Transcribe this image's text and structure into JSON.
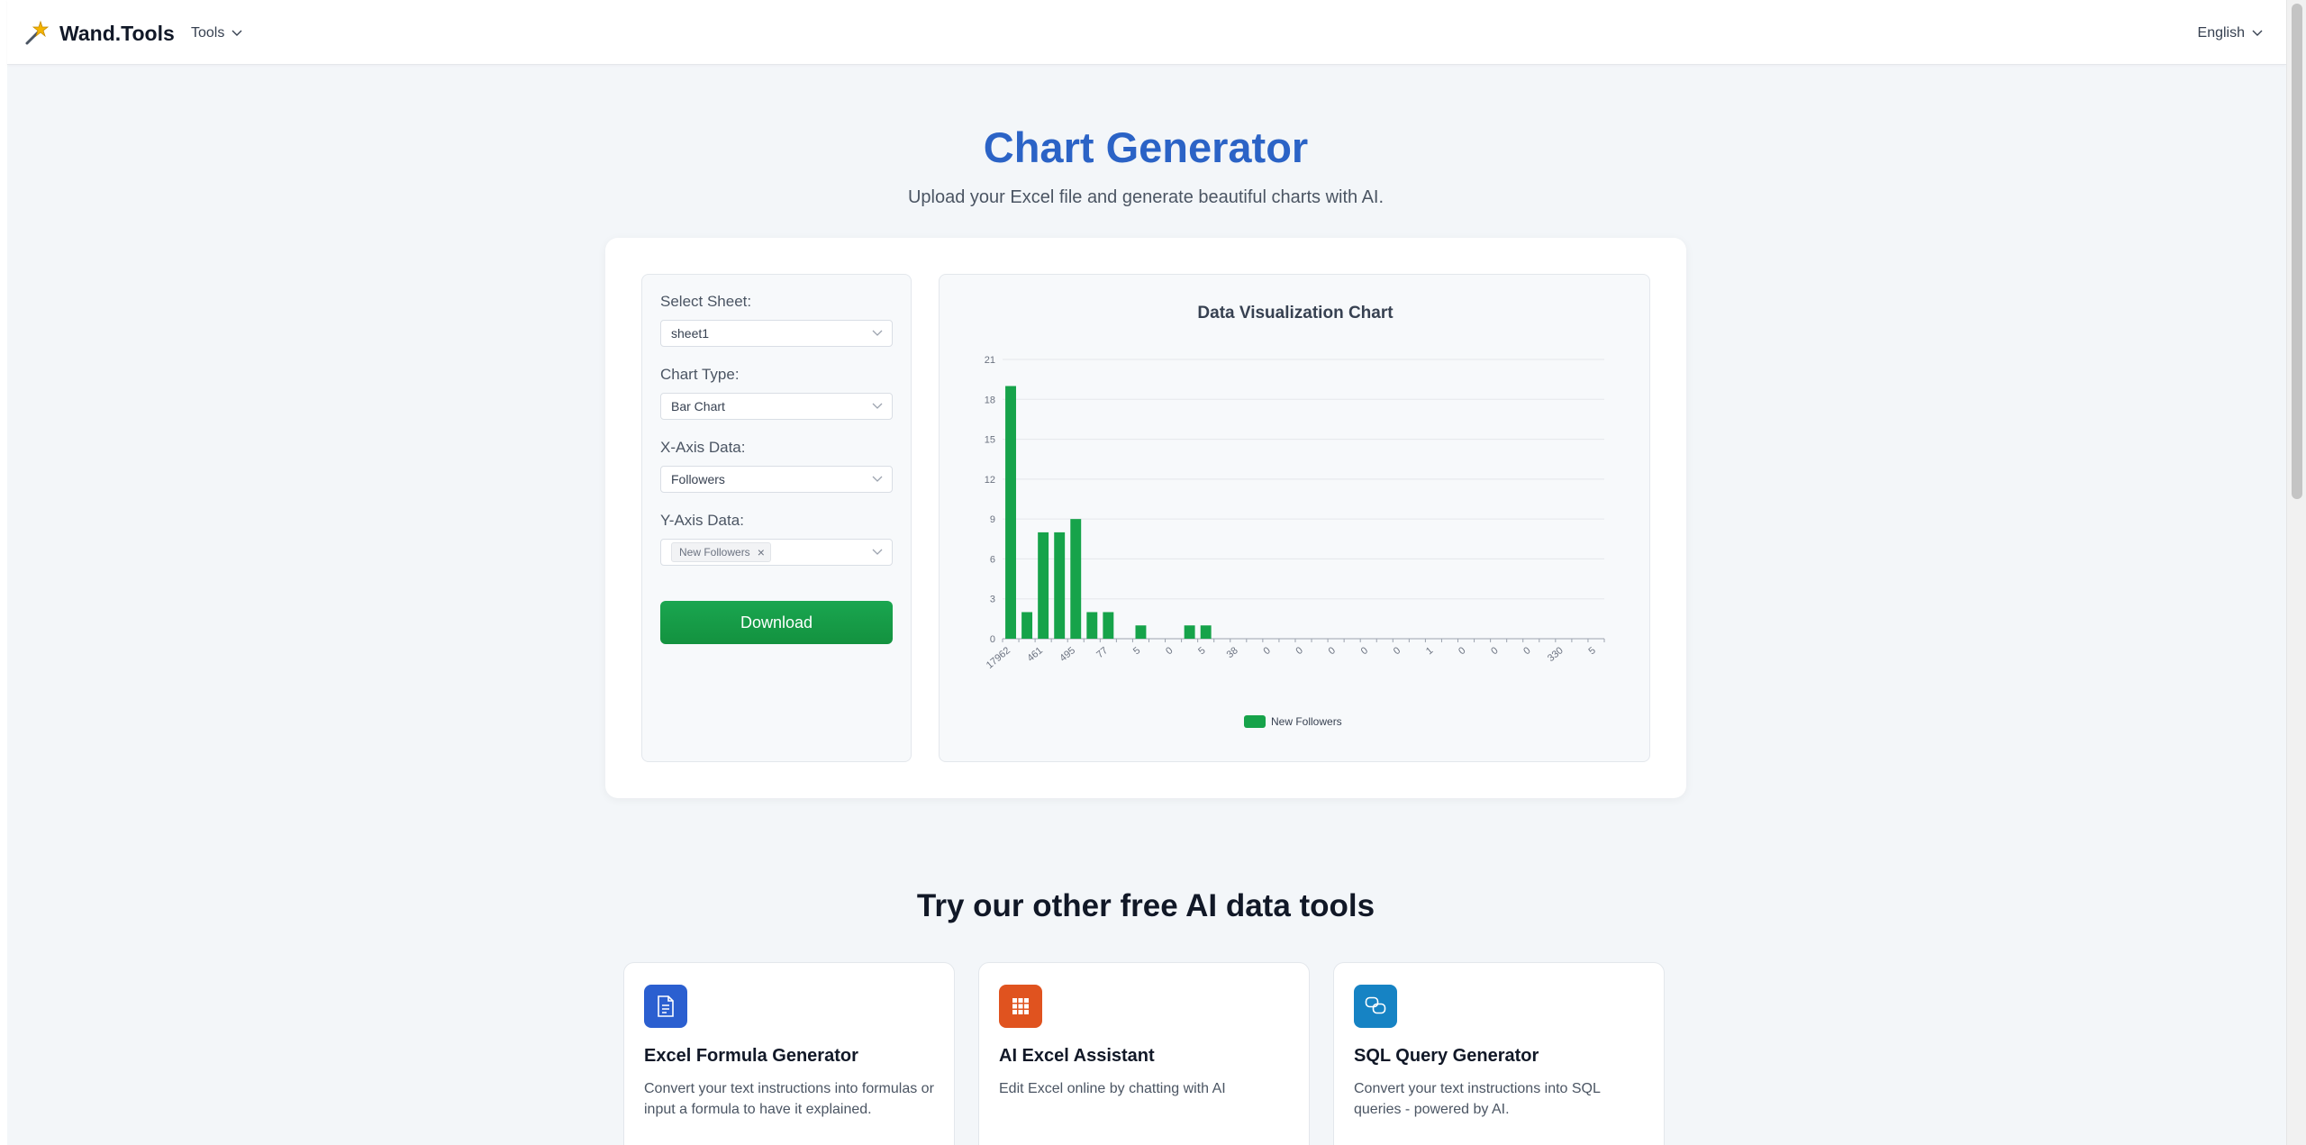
{
  "brand": {
    "name": "Wand.Tools"
  },
  "nav": {
    "tools_label": "Tools",
    "language_label": "English"
  },
  "hero": {
    "title": "Chart Generator",
    "subtitle": "Upload your Excel file and generate beautiful charts with AI."
  },
  "controls": {
    "sheet_label": "Select Sheet:",
    "sheet_value": "sheet1",
    "chart_type_label": "Chart Type:",
    "chart_type_value": "Bar Chart",
    "x_axis_label": "X-Axis Data:",
    "x_axis_value": "Followers",
    "y_axis_label": "Y-Axis Data:",
    "y_axis_tag": "New Followers",
    "download_label": "Download"
  },
  "chart_data": {
    "type": "bar",
    "title": "Data Visualization Chart",
    "xlabel": "",
    "ylabel": "",
    "ylim": [
      0,
      21
    ],
    "yticks": [
      0,
      3,
      6,
      9,
      12,
      15,
      18,
      21
    ],
    "grid": true,
    "legend_position": "bottom",
    "color": "#16a34a",
    "x_tick_labels": [
      "17962",
      "461",
      "495",
      "77",
      "5",
      "0",
      "5",
      "38",
      "0",
      "0",
      "0",
      "0",
      "0",
      "1",
      "0",
      "0",
      "0",
      "330",
      "5"
    ],
    "series": [
      {
        "name": "New Followers",
        "values": [
          19,
          2,
          8,
          8,
          9,
          2,
          2,
          0,
          1,
          0,
          0,
          1,
          1,
          0,
          0,
          0,
          0,
          0,
          0,
          0,
          0,
          0,
          0,
          0,
          0,
          0,
          0,
          0,
          0,
          0,
          0,
          0,
          0,
          0,
          0,
          0,
          0
        ]
      }
    ]
  },
  "other_tools": {
    "heading": "Try our other free AI data tools",
    "cards": [
      {
        "name": "Excel Formula Generator",
        "desc": "Convert your text instructions into formulas or input a formula to have it explained.",
        "icon": "document-icon",
        "color": "#2b5fd0"
      },
      {
        "name": "AI Excel Assistant",
        "desc": "Edit Excel online by chatting with AI",
        "icon": "grid-icon",
        "color": "#e0531f"
      },
      {
        "name": "SQL Query Generator",
        "desc": "Convert your text instructions into SQL queries - powered by AI.",
        "icon": "chat-icon",
        "color": "#1683c4"
      }
    ]
  }
}
